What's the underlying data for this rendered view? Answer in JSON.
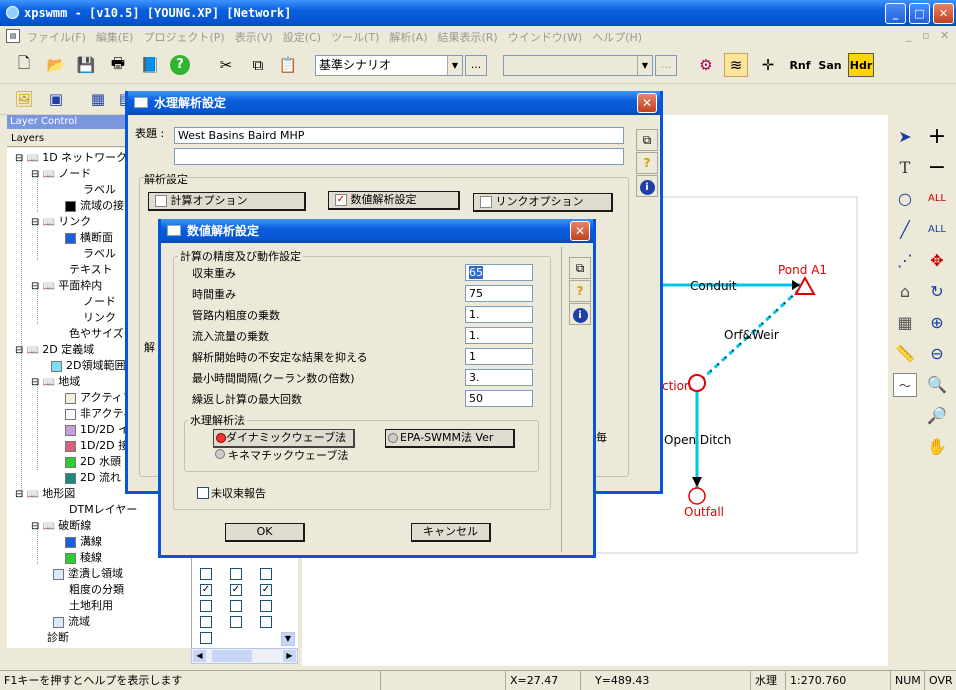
{
  "window": {
    "title": "xpswmm - [v10.5] [YOUNG.XP] [Network]"
  },
  "menu": [
    "ファイル(F)",
    "編集(E)",
    "プロジェクト(P)",
    "表示(V)",
    "設定(C)",
    "ツール(T)",
    "解析(A)",
    "結果表示(R)",
    "ウインドウ(W)",
    "ヘルプ(H)"
  ],
  "toolbar": {
    "scenario_value": "基準シナリオ",
    "ellipsis": "...",
    "rnf": "Rnf",
    "san": "San",
    "hdr": "Hdr"
  },
  "layer_control": {
    "title": "Layer Control",
    "header": "Layers",
    "items": [
      {
        "label": "1D ネットワーク"
      },
      {
        "label": "ノード"
      },
      {
        "label": "ラベル"
      },
      {
        "label": "流域の接"
      },
      {
        "label": "リンク"
      },
      {
        "label": "横断面"
      },
      {
        "label": "ラベル"
      },
      {
        "label": "テキスト"
      },
      {
        "label": "平面枠内"
      },
      {
        "label": "ノード"
      },
      {
        "label": "リンク"
      },
      {
        "label": "色やサイズ"
      },
      {
        "label": "2D 定義域"
      },
      {
        "label": "2D領域範囲"
      },
      {
        "label": "地域"
      },
      {
        "label": "アクティブ"
      },
      {
        "label": "非アクティ"
      },
      {
        "label": "1D/2D イ"
      },
      {
        "label": "1D/2D 接"
      },
      {
        "label": "2D 水頭"
      },
      {
        "label": "2D 流れ"
      },
      {
        "label": "地形図"
      },
      {
        "label": "DTMレイヤー"
      },
      {
        "label": "破断線"
      },
      {
        "label": "溝線"
      },
      {
        "label": "稜線"
      },
      {
        "label": "塗潰し領域"
      },
      {
        "label": "粗度の分類"
      },
      {
        "label": "土地利用"
      },
      {
        "label": "流域"
      },
      {
        "label": "診断"
      }
    ]
  },
  "network": {
    "conduit": "Conduit",
    "pond": "Pond A1",
    "orf_weir": "Orf&Weir",
    "junction": "ction",
    "open_ditch": "Open Ditch",
    "outfall": "Outfall"
  },
  "hydraulics_dialog": {
    "title": "水理解析設定",
    "title_label": "表題 :",
    "title_value": "West Basins Baird MHP",
    "title_value2": "",
    "section_label": "解析設定",
    "btn_calc_options": "計算オプション",
    "btn_numeric": "数値解析設定",
    "btn_link_options": "リンクオプション",
    "partial": "解",
    "partial2": "毎"
  },
  "numeric_dialog": {
    "title": "数値解析設定",
    "group_label": "計算の精度及び動作設定",
    "params": [
      {
        "label": "収束重み",
        "value": "65"
      },
      {
        "label": "時間重み",
        "value": "75"
      },
      {
        "label": "管路内粗度の乗数",
        "value": "1."
      },
      {
        "label": "流入流量の乗数",
        "value": "1."
      },
      {
        "label": "解析開始時の不安定な結果を抑える",
        "value": "1"
      },
      {
        "label": "最小時間間隔(クーラン数の倍数)",
        "value": "3."
      },
      {
        "label": "繰返し計算の最大回数",
        "value": "50"
      }
    ],
    "method_group": "水理解析法",
    "radio_dynamic": "ダイナミックウェーブ法",
    "radio_epa": "EPA-SWMM法 Ver",
    "radio_kinematic": "キネマチックウェーブ法",
    "nonconv_label": "未収束報告",
    "ok": "OK",
    "cancel": "キャンセル"
  },
  "status": {
    "help": "F1キーを押すとヘルプを表示します",
    "x": "X=27.47",
    "y": "Y=489.43",
    "mode": "水理",
    "scale": "1:270.760",
    "num": "NUM",
    "ovr": "OVR"
  },
  "colors": {
    "accent": "#0855dd",
    "link": "#00c5e8",
    "node": "#e00000",
    "pond_label": "#e00000"
  }
}
